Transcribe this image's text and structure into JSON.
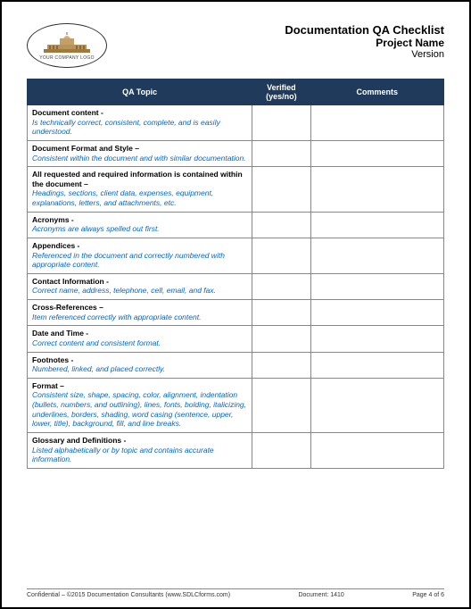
{
  "header": {
    "logo_label": "YOUR COMPANY LOGO",
    "title1": "Documentation QA Checklist",
    "title2": "Project Name",
    "title3": "Version"
  },
  "table": {
    "headers": {
      "col1": "QA Topic",
      "col2": "Verified (yes/no)",
      "col3": "Comments"
    },
    "rows": [
      {
        "title": "Document content -",
        "desc": "Is technically correct, consistent, complete, and is easily understood."
      },
      {
        "title": "Document Format and Style –",
        "desc": "Consistent within the document and with similar documentation."
      },
      {
        "title": "All requested and required information is contained within the document –",
        "desc": "Headings, sections, client data, expenses, equipment, explanations, letters, and attachments, etc."
      },
      {
        "title": "Acronyms -",
        "desc": "Acronyms are always spelled out first."
      },
      {
        "title": "Appendices -",
        "desc": "Referenced in the document and correctly numbered with appropriate content."
      },
      {
        "title": "Contact Information -",
        "desc": "Correct name, address, telephone, cell, email, and fax."
      },
      {
        "title": "Cross-References –",
        "desc": "Item referenced correctly with appropriate content."
      },
      {
        "title": "Date and Time -",
        "desc": "Correct content and consistent format."
      },
      {
        "title": "Footnotes -",
        "desc": "Numbered, linked, and placed correctly."
      },
      {
        "title": "Format –",
        "desc": "Consistent size, shape, spacing, color, alignment, indentation (bullets, numbers, and outlining), lines, fonts, bolding, italicizing, underlines, borders, shading, word casing (sentence, upper, lower, title), background, fill, and line breaks."
      },
      {
        "title": "Glossary and Definitions -",
        "desc": "Listed alphabetically or by topic and contains accurate information."
      }
    ]
  },
  "footer": {
    "left": "Confidential – ©2015 Documentation Consultants (www.SDLCforms.com)",
    "mid": "Document: 1410",
    "right": "Page 4 of 6"
  }
}
